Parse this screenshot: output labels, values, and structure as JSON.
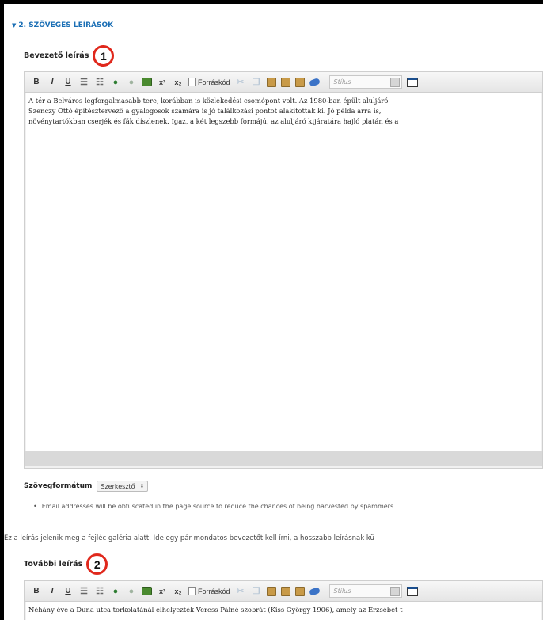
{
  "section": {
    "title": "2. SZÖVEGES LEÍRÁSOK"
  },
  "field1": {
    "label": "Bevezető leírás",
    "badge": "1",
    "paragraphs": [
      "A tér a Belváros legforgalmasabb tere, korábban is közlekedési csomópont volt. Az 1980-ban épült aluljáró",
      "Szenczy Ottó építésztervező a gyalogosok számára is jó találkozási pontot alakítottak ki. Jó példa arra is,",
      "növénytartókban cserjék és fák díszlenek. Igaz, a két legszebb formájú, az aluljáró kijáratára hajló platán és a"
    ]
  },
  "toolbar": {
    "bold": "B",
    "italic": "I",
    "underline": "U",
    "bullet_list": "☰",
    "numbered_list": "☷",
    "superscript": "x²",
    "subscript": "x₂",
    "source": "Forráskód",
    "style_placeholder": "Stílus"
  },
  "format": {
    "label": "Szövegformátum",
    "value": "Szerkesztő"
  },
  "hint": "Email addresses will be obfuscated in the page source to reduce the chances of being harvested by spammers.",
  "description": "Ez a leírás jelenik meg a fejléc galéria alatt. Ide egy pár mondatos bevezetőt kell írni, a hosszabb leírásnak kü",
  "field2": {
    "label": "További leírás",
    "badge": "2",
    "paragraphs": [
      "Néhány éve a Duna utca torkolatánál elhelyezték Veress Pálné szobrát (Kiss György 1906), amely az Erzsébet t"
    ]
  },
  "icons": {
    "section_toggle": "triangle-down-icon",
    "link": "globe-link-icon",
    "unlink": "globe-unlink-icon",
    "image": "image-icon",
    "source": "source-doc-icon",
    "paste": "paste-icon",
    "paste_text": "paste-text-icon",
    "paste_word": "paste-word-icon",
    "eraser": "remove-format-icon",
    "maximize": "maximize-icon"
  },
  "colors": {
    "section_header": "#1b6fb5",
    "badge_ring": "#e0281c"
  }
}
